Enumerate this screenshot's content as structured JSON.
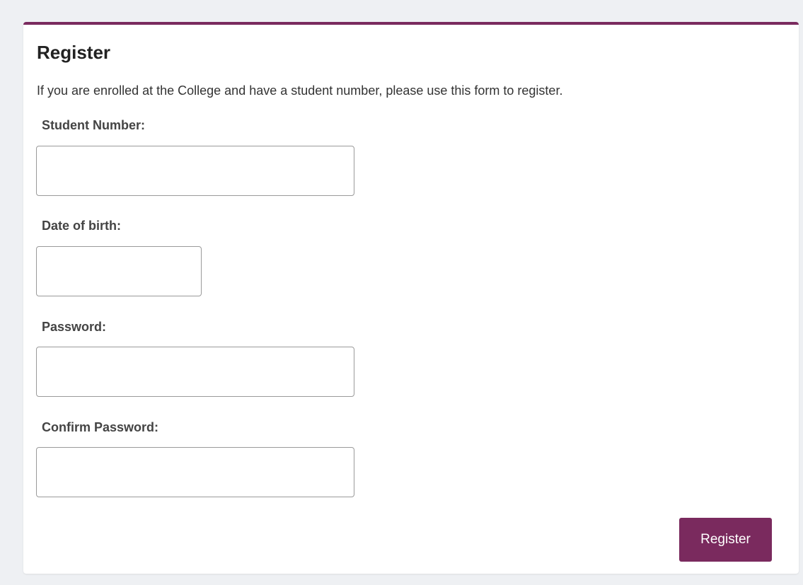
{
  "card": {
    "title": "Register",
    "intro": "If you are enrolled at the College and have a student number, please use this form to register."
  },
  "fields": {
    "student_number": {
      "label": "Student Number:",
      "value": "",
      "placeholder": ""
    },
    "date_of_birth": {
      "label": "Date of birth:",
      "value": "",
      "placeholder": ""
    },
    "password": {
      "label": "Password:",
      "value": "",
      "placeholder": ""
    },
    "confirm_password": {
      "label": "Confirm Password:",
      "value": "",
      "placeholder": ""
    }
  },
  "actions": {
    "register_label": "Register"
  },
  "colors": {
    "accent": "#7a2a5e",
    "page_background": "#eef0f3"
  }
}
